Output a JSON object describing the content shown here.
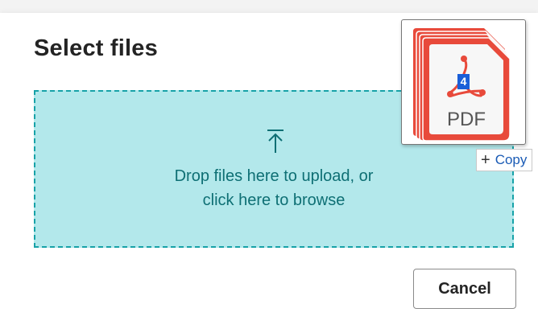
{
  "dialog": {
    "title": "Select files",
    "dropzone": {
      "line1": "Drop files here to upload, or",
      "line2": "click here to browse",
      "icon": "upload-arrow-icon"
    },
    "cancel_label": "Cancel"
  },
  "drag_preview": {
    "file_label": "PDF",
    "file_count": "4",
    "icon": "pdf-file-stack-icon",
    "action_label": "Copy",
    "action_icon": "plus-icon"
  },
  "colors": {
    "dropzone_bg": "#b3e8eb",
    "dropzone_border": "#17a2a8",
    "dropzone_text": "#0e6f74",
    "pdf_red": "#e84a3b",
    "badge_blue": "#1a5ed8",
    "copy_text": "#1a5bb5"
  }
}
